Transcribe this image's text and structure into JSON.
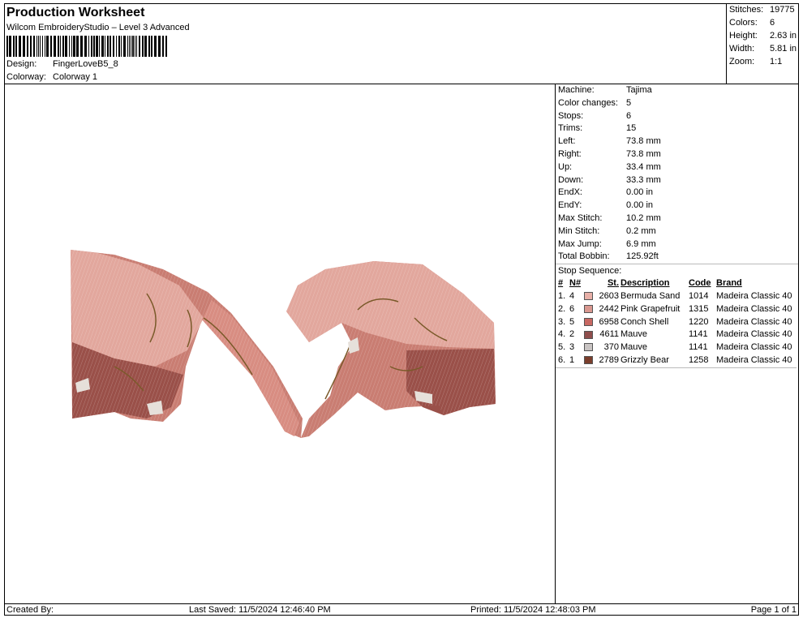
{
  "header": {
    "title": "Production Worksheet",
    "subtitle": "Wilcom EmbroideryStudio – Level 3 Advanced",
    "design_label": "Design:",
    "design_value": "FingerLoveB5_8",
    "colorway_label": "Colorway:",
    "colorway_value": "Colorway 1"
  },
  "stats": [
    {
      "label": "Stitches:",
      "value": "19775"
    },
    {
      "label": "Colors:",
      "value": "6"
    },
    {
      "label": "Height:",
      "value": "2.63 in"
    },
    {
      "label": "Width:",
      "value": "5.81 in"
    },
    {
      "label": "Zoom:",
      "value": "1:1"
    }
  ],
  "info": [
    {
      "label": "Machine:",
      "value": "Tajima"
    },
    {
      "label": "Color changes:",
      "value": "5"
    },
    {
      "label": "Stops:",
      "value": "6"
    },
    {
      "label": "Trims:",
      "value": "15"
    },
    {
      "label": "Left:",
      "value": "73.8 mm"
    },
    {
      "label": "Right:",
      "value": "73.8 mm"
    },
    {
      "label": "Up:",
      "value": "33.4 mm"
    },
    {
      "label": "Down:",
      "value": "33.3 mm"
    },
    {
      "label": "EndX:",
      "value": "0.00 in"
    },
    {
      "label": "EndY:",
      "value": "0.00 in"
    },
    {
      "label": "Max Stitch:",
      "value": "10.2 mm"
    },
    {
      "label": "Min Stitch:",
      "value": "0.2 mm"
    },
    {
      "label": "Max Jump:",
      "value": "6.9 mm"
    },
    {
      "label": "Total Bobbin:",
      "value": "125.92ft"
    }
  ],
  "stop_sequence": {
    "title": "Stop Sequence:",
    "headers": [
      "#",
      "N#",
      "St.",
      "Description",
      "Code",
      "Brand"
    ],
    "rows": [
      {
        "idx": "1.",
        "n": "4",
        "color": "#e8b0a8",
        "st": "2603",
        "desc": "Bermuda Sand",
        "code": "1014",
        "brand": "Madeira Classic 40"
      },
      {
        "idx": "2.",
        "n": "6",
        "color": "#d99890",
        "st": "2442",
        "desc": "Pink Grapefruit",
        "code": "1315",
        "brand": "Madeira Classic 40"
      },
      {
        "idx": "3.",
        "n": "5",
        "color": "#c86862",
        "st": "6958",
        "desc": "Conch Shell",
        "code": "1220",
        "brand": "Madeira Classic 40"
      },
      {
        "idx": "4.",
        "n": "2",
        "color": "#8f4e4c",
        "st": "4611",
        "desc": "Mauve",
        "code": "1141",
        "brand": "Madeira Classic 40"
      },
      {
        "idx": "5.",
        "n": "3",
        "color": "#c9c4c3",
        "st": "370",
        "desc": "Mauve",
        "code": "1141",
        "brand": "Madeira Classic 40"
      },
      {
        "idx": "6.",
        "n": "1",
        "color": "#7a3e2c",
        "st": "2789",
        "desc": "Grizzly Bear",
        "code": "1258",
        "brand": "Madeira Classic 40"
      }
    ]
  },
  "footer": {
    "created_by": "Created By:",
    "last_saved": "Last Saved: 11/5/2024 12:46:40 PM",
    "printed": "Printed: 11/5/2024 12:48:03 PM",
    "page": "Page 1 of 1"
  }
}
